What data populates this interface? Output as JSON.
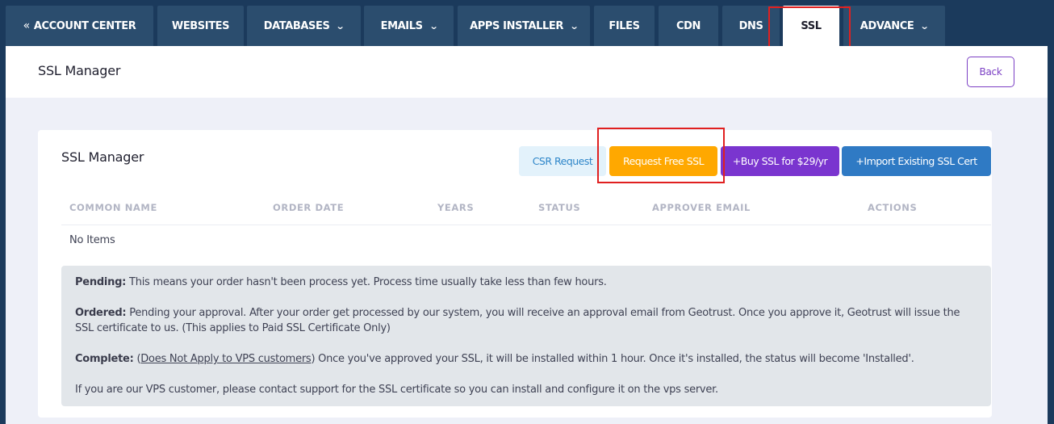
{
  "nav": {
    "account_center": "ACCOUNT CENTER",
    "back_glyph": "«",
    "tabs": [
      {
        "label": "WEBSITES"
      },
      {
        "label": "DATABASES"
      },
      {
        "label": "EMAILS"
      },
      {
        "label": "APPS INSTALLER"
      },
      {
        "label": "FILES"
      },
      {
        "label": "CDN"
      },
      {
        "label": "DNS"
      },
      {
        "label": "SSL"
      },
      {
        "label": "ADVANCE"
      }
    ],
    "active_tab": "SSL",
    "chevron": "⌄"
  },
  "header": {
    "title": "SSL Manager",
    "back_label": "Back"
  },
  "card": {
    "title": "SSL Manager",
    "buttons": {
      "csr": "CSR Request",
      "free": "Request Free SSL",
      "buy": "+Buy SSL for $29/yr",
      "import": "+Import Existing SSL Cert"
    },
    "columns": [
      "COMMON NAME",
      "ORDER DATE",
      "YEARS",
      "STATUS",
      "APPROVER EMAIL",
      "ACTIONS"
    ],
    "empty_text": "No Items"
  },
  "info": {
    "pending_label": "Pending:",
    "pending_text": " This means your order hasn't been process yet. Process time usually take less than few hours.",
    "ordered_label": "Ordered:",
    "ordered_text": " Pending your approval. After your order get processed by our system, you will receive an approval email from Geotrust. Once you approve it, Geotrust will issue the SSL certificate to us. (This applies to Paid SSL Certificate Only)",
    "complete_label": "Complete:",
    "complete_open": " (",
    "complete_note": "Does Not Apply to VPS customers",
    "complete_text": ") Once you've approved your SSL, it will be installed within 1 hour. Once it's installed, the status will become 'Installed'.",
    "vps_text": "If you are our VPS customer, please contact support for the SSL certificate so you can install and configure it on the vps server."
  },
  "colors": {
    "nav_bg": "#1b3a5c",
    "tab_bg": "#2b4d6e",
    "accent_orange": "#ffa800",
    "accent_purple": "#7a35cf",
    "accent_blue": "#2f7ac4",
    "highlight": "#e02020"
  }
}
